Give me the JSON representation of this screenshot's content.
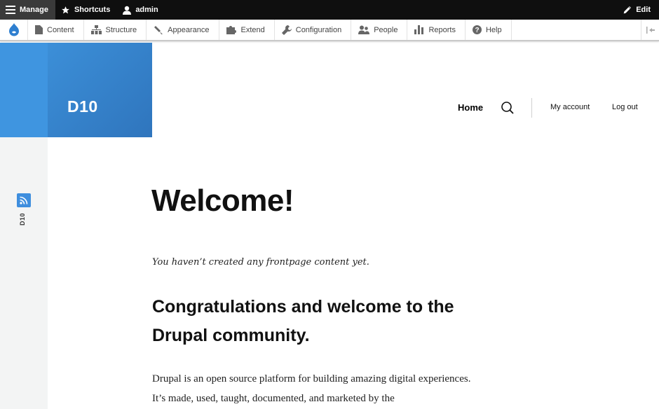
{
  "toolbar": {
    "manage": "Manage",
    "shortcuts": "Shortcuts",
    "user": "admin",
    "edit": "Edit"
  },
  "tray": {
    "items": [
      {
        "label": "Content",
        "icon": "document-icon"
      },
      {
        "label": "Structure",
        "icon": "sitemap-icon"
      },
      {
        "label": "Appearance",
        "icon": "brush-icon"
      },
      {
        "label": "Extend",
        "icon": "puzzle-icon"
      },
      {
        "label": "Configuration",
        "icon": "wrench-icon"
      },
      {
        "label": "People",
        "icon": "people-icon"
      },
      {
        "label": "Reports",
        "icon": "bar-chart-icon"
      },
      {
        "label": "Help",
        "icon": "help-icon"
      }
    ]
  },
  "sidebar": {
    "label": "D10"
  },
  "site": {
    "name": "D10"
  },
  "nav": {
    "home": "Home",
    "my_account": "My account",
    "log_out": "Log out"
  },
  "main": {
    "title": "Welcome!",
    "no_content": "You haven’t created any frontpage content yet.",
    "heading": "Congratulations and welcome to the Drupal community.",
    "intro": "Drupal is an open source platform for building amazing digital experiences. It’s made, used, taught, documented, and marketed by the"
  },
  "colors": {
    "brand_blue": "#3f95e0",
    "toolbar_black": "#0f0f0f"
  }
}
